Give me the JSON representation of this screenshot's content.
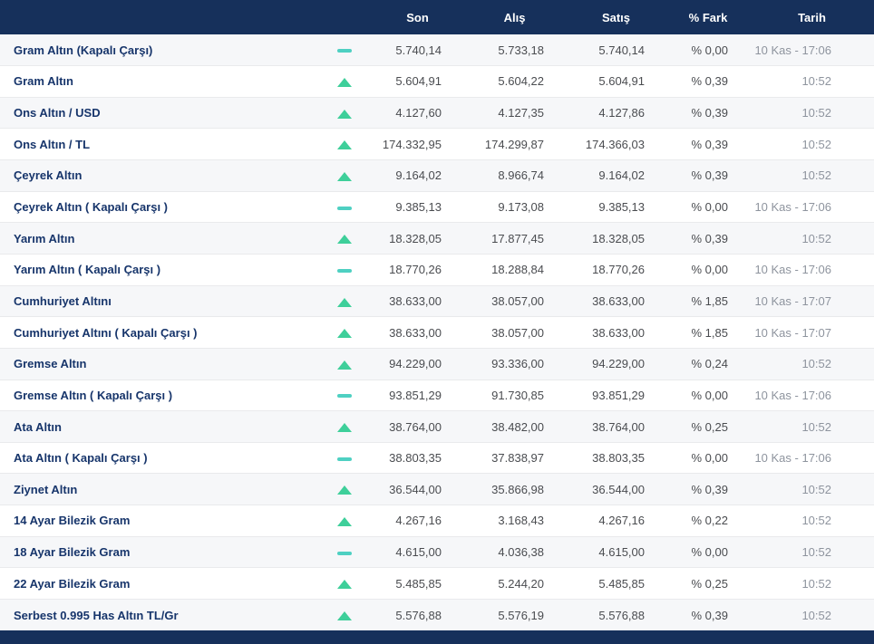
{
  "colors": {
    "header_bg": "#16305b",
    "footer_bg": "#16305b",
    "name_text": "#17356b",
    "up_icon": "#3ecf9a",
    "flat_icon": "#4ed0c2",
    "row_alt_bg": "#f6f7f9"
  },
  "icons": {
    "up": "trend-up-icon",
    "flat": "trend-flat-icon"
  },
  "table": {
    "columns": {
      "son": "Son",
      "alis": "Alış",
      "satis": "Satış",
      "fark": "% Fark",
      "tarih": "Tarih"
    },
    "rows": [
      {
        "name": "Gram Altın (Kapalı Çarşı)",
        "direction": "flat",
        "son": "5.740,14",
        "alis": "5.733,18",
        "satis": "5.740,14",
        "fark": "% 0,00",
        "tarih": "10 Kas - 17:06"
      },
      {
        "name": "Gram Altın",
        "direction": "up",
        "son": "5.604,91",
        "alis": "5.604,22",
        "satis": "5.604,91",
        "fark": "% 0,39",
        "tarih": "10:52"
      },
      {
        "name": "Ons Altın / USD",
        "direction": "up",
        "son": "4.127,60",
        "alis": "4.127,35",
        "satis": "4.127,86",
        "fark": "% 0,39",
        "tarih": "10:52"
      },
      {
        "name": "Ons Altın / TL",
        "direction": "up",
        "son": "174.332,95",
        "alis": "174.299,87",
        "satis": "174.366,03",
        "fark": "% 0,39",
        "tarih": "10:52"
      },
      {
        "name": "Çeyrek Altın",
        "direction": "up",
        "son": "9.164,02",
        "alis": "8.966,74",
        "satis": "9.164,02",
        "fark": "% 0,39",
        "tarih": "10:52"
      },
      {
        "name": "Çeyrek Altın ( Kapalı Çarşı )",
        "direction": "flat",
        "son": "9.385,13",
        "alis": "9.173,08",
        "satis": "9.385,13",
        "fark": "% 0,00",
        "tarih": "10 Kas - 17:06"
      },
      {
        "name": "Yarım Altın",
        "direction": "up",
        "son": "18.328,05",
        "alis": "17.877,45",
        "satis": "18.328,05",
        "fark": "% 0,39",
        "tarih": "10:52"
      },
      {
        "name": "Yarım Altın ( Kapalı Çarşı )",
        "direction": "flat",
        "son": "18.770,26",
        "alis": "18.288,84",
        "satis": "18.770,26",
        "fark": "% 0,00",
        "tarih": "10 Kas - 17:06"
      },
      {
        "name": "Cumhuriyet Altını",
        "direction": "up",
        "son": "38.633,00",
        "alis": "38.057,00",
        "satis": "38.633,00",
        "fark": "% 1,85",
        "tarih": "10 Kas - 17:07"
      },
      {
        "name": "Cumhuriyet Altını ( Kapalı Çarşı )",
        "direction": "up",
        "son": "38.633,00",
        "alis": "38.057,00",
        "satis": "38.633,00",
        "fark": "% 1,85",
        "tarih": "10 Kas - 17:07"
      },
      {
        "name": "Gremse Altın",
        "direction": "up",
        "son": "94.229,00",
        "alis": "93.336,00",
        "satis": "94.229,00",
        "fark": "% 0,24",
        "tarih": "10:52"
      },
      {
        "name": "Gremse Altın ( Kapalı Çarşı )",
        "direction": "flat",
        "son": "93.851,29",
        "alis": "91.730,85",
        "satis": "93.851,29",
        "fark": "% 0,00",
        "tarih": "10 Kas - 17:06"
      },
      {
        "name": "Ata Altın",
        "direction": "up",
        "son": "38.764,00",
        "alis": "38.482,00",
        "satis": "38.764,00",
        "fark": "% 0,25",
        "tarih": "10:52"
      },
      {
        "name": "Ata Altın ( Kapalı Çarşı )",
        "direction": "flat",
        "son": "38.803,35",
        "alis": "37.838,97",
        "satis": "38.803,35",
        "fark": "% 0,00",
        "tarih": "10 Kas - 17:06"
      },
      {
        "name": "Ziynet Altın",
        "direction": "up",
        "son": "36.544,00",
        "alis": "35.866,98",
        "satis": "36.544,00",
        "fark": "% 0,39",
        "tarih": "10:52"
      },
      {
        "name": "14 Ayar Bilezik Gram",
        "direction": "up",
        "son": "4.267,16",
        "alis": "3.168,43",
        "satis": "4.267,16",
        "fark": "% 0,22",
        "tarih": "10:52"
      },
      {
        "name": "18 Ayar Bilezik Gram",
        "direction": "flat",
        "son": "4.615,00",
        "alis": "4.036,38",
        "satis": "4.615,00",
        "fark": "% 0,00",
        "tarih": "10:52"
      },
      {
        "name": "22 Ayar Bilezik Gram",
        "direction": "up",
        "son": "5.485,85",
        "alis": "5.244,20",
        "satis": "5.485,85",
        "fark": "% 0,25",
        "tarih": "10:52"
      },
      {
        "name": "Serbest 0.995 Has Altın TL/Gr",
        "direction": "up",
        "son": "5.576,88",
        "alis": "5.576,19",
        "satis": "5.576,88",
        "fark": "% 0,39",
        "tarih": "10:52"
      }
    ]
  }
}
